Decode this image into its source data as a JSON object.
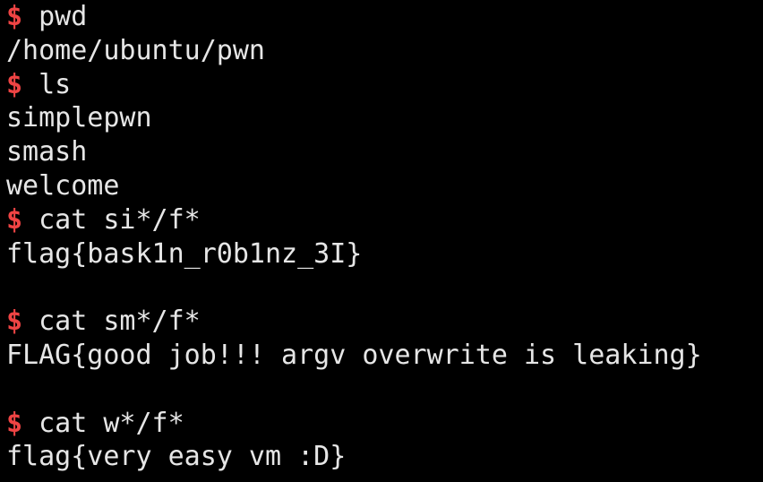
{
  "colors": {
    "background": "#000000",
    "text": "#e6e6e6",
    "prompt": "#ef4444"
  },
  "prompt_symbol": "$",
  "lines": [
    {
      "type": "command",
      "text": " pwd"
    },
    {
      "type": "output",
      "text": "/home/ubuntu/pwn"
    },
    {
      "type": "command",
      "text": " ls"
    },
    {
      "type": "output",
      "text": "simplepwn"
    },
    {
      "type": "output",
      "text": "smash"
    },
    {
      "type": "output",
      "text": "welcome"
    },
    {
      "type": "command",
      "text": " cat si*/f*"
    },
    {
      "type": "output",
      "text": "flag{bask1n_r0b1nz_3I}"
    },
    {
      "type": "blank",
      "text": ""
    },
    {
      "type": "command",
      "text": " cat sm*/f*"
    },
    {
      "type": "output",
      "text": "FLAG{good job!!! argv overwrite is leaking}"
    },
    {
      "type": "blank",
      "text": ""
    },
    {
      "type": "command",
      "text": " cat w*/f*"
    },
    {
      "type": "output",
      "text": "flag{very easy vm :D}"
    }
  ]
}
